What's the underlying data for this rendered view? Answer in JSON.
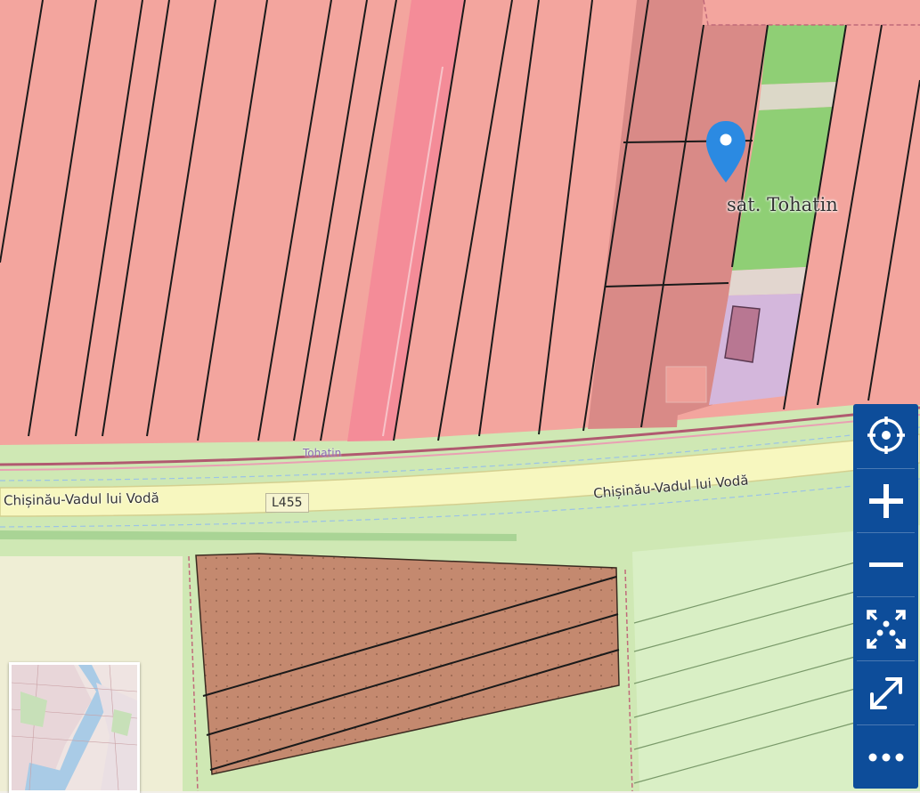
{
  "map": {
    "marker_label": "sat. Tohatin",
    "place_label": "Tohatin",
    "road_name_left": "Chișinău-Vadul lui Vodă",
    "road_name_right": "Chișinău-Vadul lui Vodă",
    "road_ref": "L455",
    "colors": {
      "parcel_pink": "#f3a59e",
      "parcel_dark": "#d98a87",
      "road_strip_pink": "#f48c98",
      "grass": "#cfe8b4",
      "meadow": "#8fcf75",
      "road_yellow": "#f7f7bf",
      "farmland_brown": "#c4896f",
      "building_lilac": "#d4b7dc",
      "control_blue": "#0d4d9a",
      "marker_blue": "#2b8ae2"
    }
  },
  "controls": {
    "locate": "locate-icon",
    "zoom_in": "plus-icon",
    "zoom_out": "minus-icon",
    "fit": "fit-bounds-icon",
    "fullscreen": "expand-icon",
    "more": "more-icon"
  },
  "minimap": {
    "icon": "minimap-thumbnail"
  }
}
